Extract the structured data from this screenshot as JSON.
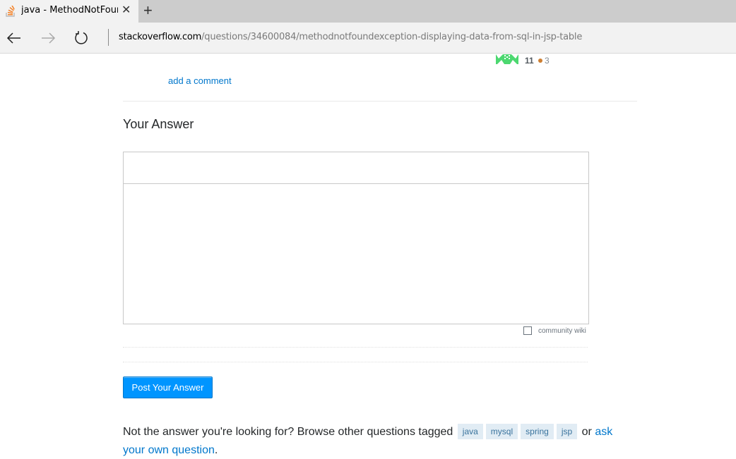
{
  "browser": {
    "tab_title": "java - MethodNotFound",
    "url_host": "stackoverflow.com",
    "url_path": "/questions/34600084/methodnotfoundexception-displaying-data-from-sql-in-jsp-table"
  },
  "user_card": {
    "reputation": "11",
    "bronze_badges": "3",
    "badge_color": "#cd7f32"
  },
  "comments": {
    "add_comment": "add a comment"
  },
  "answer_form": {
    "heading": "Your Answer",
    "community_wiki_label": "community wiki",
    "community_wiki_checked": false,
    "post_button": "Post Your Answer"
  },
  "footer": {
    "prefix": "Not the answer you're looking for? Browse other questions tagged",
    "tags": [
      "java",
      "mysql",
      "spring",
      "jsp"
    ],
    "or_text": "or",
    "ask_link": "ask your own question",
    "suffix": "."
  }
}
